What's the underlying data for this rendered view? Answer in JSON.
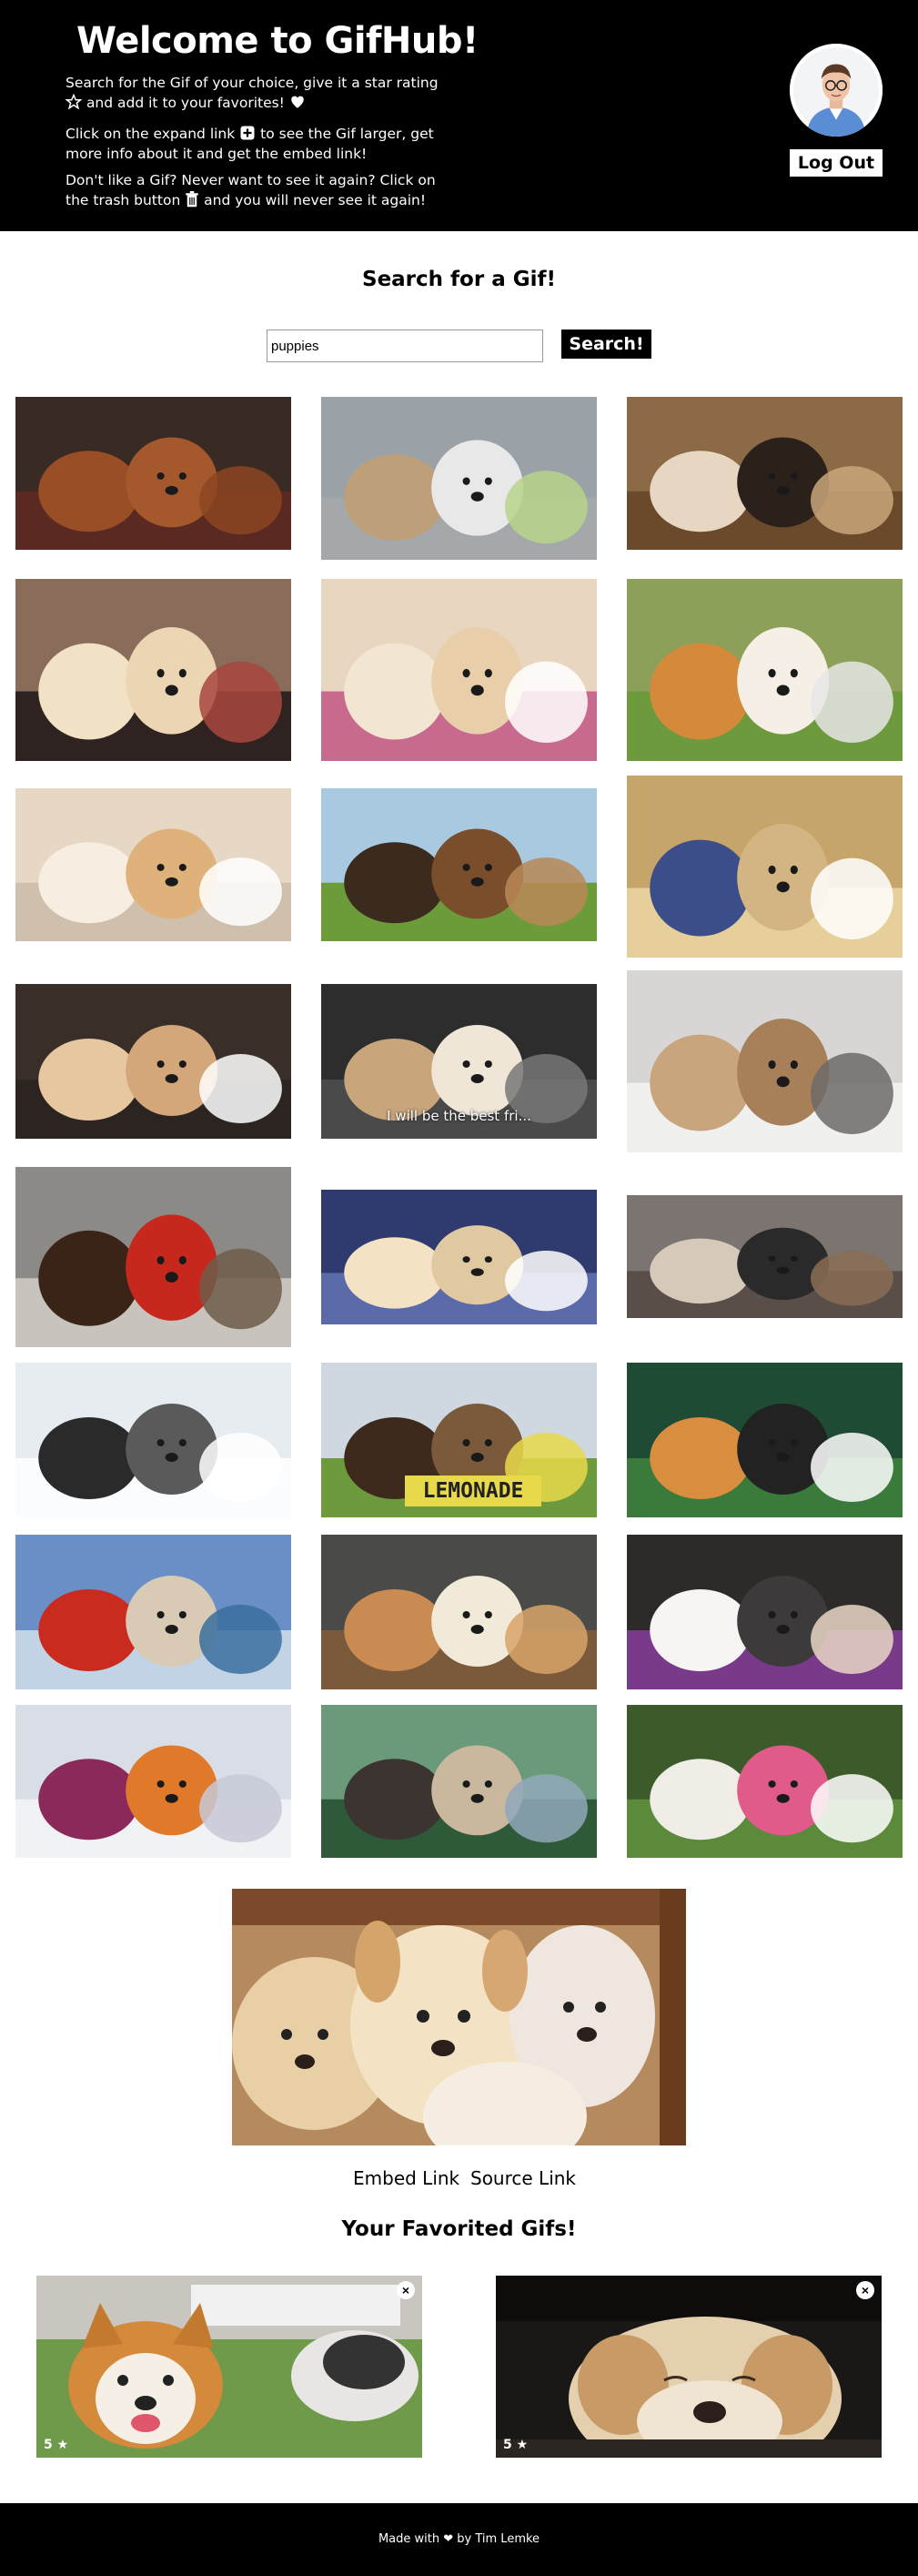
{
  "header": {
    "title": "Welcome to GifHub!",
    "intro_1_a": "Search for the Gif of your choice, give it a star rating",
    "intro_1_b": "and add it to your favorites!",
    "intro_2_a": "Click on the expand link",
    "intro_2_b": "to see the Gif larger, get more info about it and get the embed link!",
    "intro_3_a": "Don't like a Gif? Never want to see it again? Click on the trash button",
    "intro_3_b": "and you will never see it again!",
    "logout_label": "Log Out",
    "icons": [
      "star-outline-icon",
      "heart-icon",
      "plus-square-icon",
      "trash-icon"
    ]
  },
  "search": {
    "title": "Search for a Gif!",
    "value": "puppies",
    "button_label": "Search!"
  },
  "results": [
    {
      "name": "gif-puppies-question-marks"
    },
    {
      "name": "gif-puppy-bicycle"
    },
    {
      "name": "gif-puppies-doghouse"
    },
    {
      "name": "gif-puppies-crib"
    },
    {
      "name": "gif-puppies-sleeping-paws"
    },
    {
      "name": "gif-corgi-puppies-basket"
    },
    {
      "name": "gif-golden-puppies-pile"
    },
    {
      "name": "gif-puppies-grass-boxes"
    },
    {
      "name": "gif-puppies-on-person"
    },
    {
      "name": "gif-sleepy-puppy"
    },
    {
      "name": "gif-puppy-best-friend",
      "caption": "I will be the best fri..."
    },
    {
      "name": "gif-puppies-snow-herd"
    },
    {
      "name": "gif-corgi-living-room"
    },
    {
      "name": "gif-puppies-in-box"
    },
    {
      "name": "gif-husky-puppy-man"
    },
    {
      "name": "gif-puppies-snow-dogs"
    },
    {
      "name": "gif-puppies-lemonade-stand",
      "caption": "LEMONADE"
    },
    {
      "name": "gif-shiba-trampoline"
    },
    {
      "name": "gif-little-mermaid-dog"
    },
    {
      "name": "gif-dogs-ice-cream-car"
    },
    {
      "name": "gif-fluffy-puppy-grooming"
    },
    {
      "name": "gif-puppy-snowman"
    },
    {
      "name": "gif-people-holding-puppies"
    },
    {
      "name": "gif-girl-with-puppies"
    }
  ],
  "expanded": {
    "embed_link": "Embed Link",
    "source_link": "Source Link"
  },
  "favorites": {
    "title": "Your Favorited Gifs!",
    "items": [
      {
        "rating": "5",
        "close_icon": "close-icon",
        "star_icon": "star-icon"
      },
      {
        "rating": "5",
        "close_icon": "close-icon",
        "star_icon": "star-icon"
      }
    ]
  },
  "footer": {
    "made_with": "Made with",
    "by": "by Tim Lemke"
  }
}
